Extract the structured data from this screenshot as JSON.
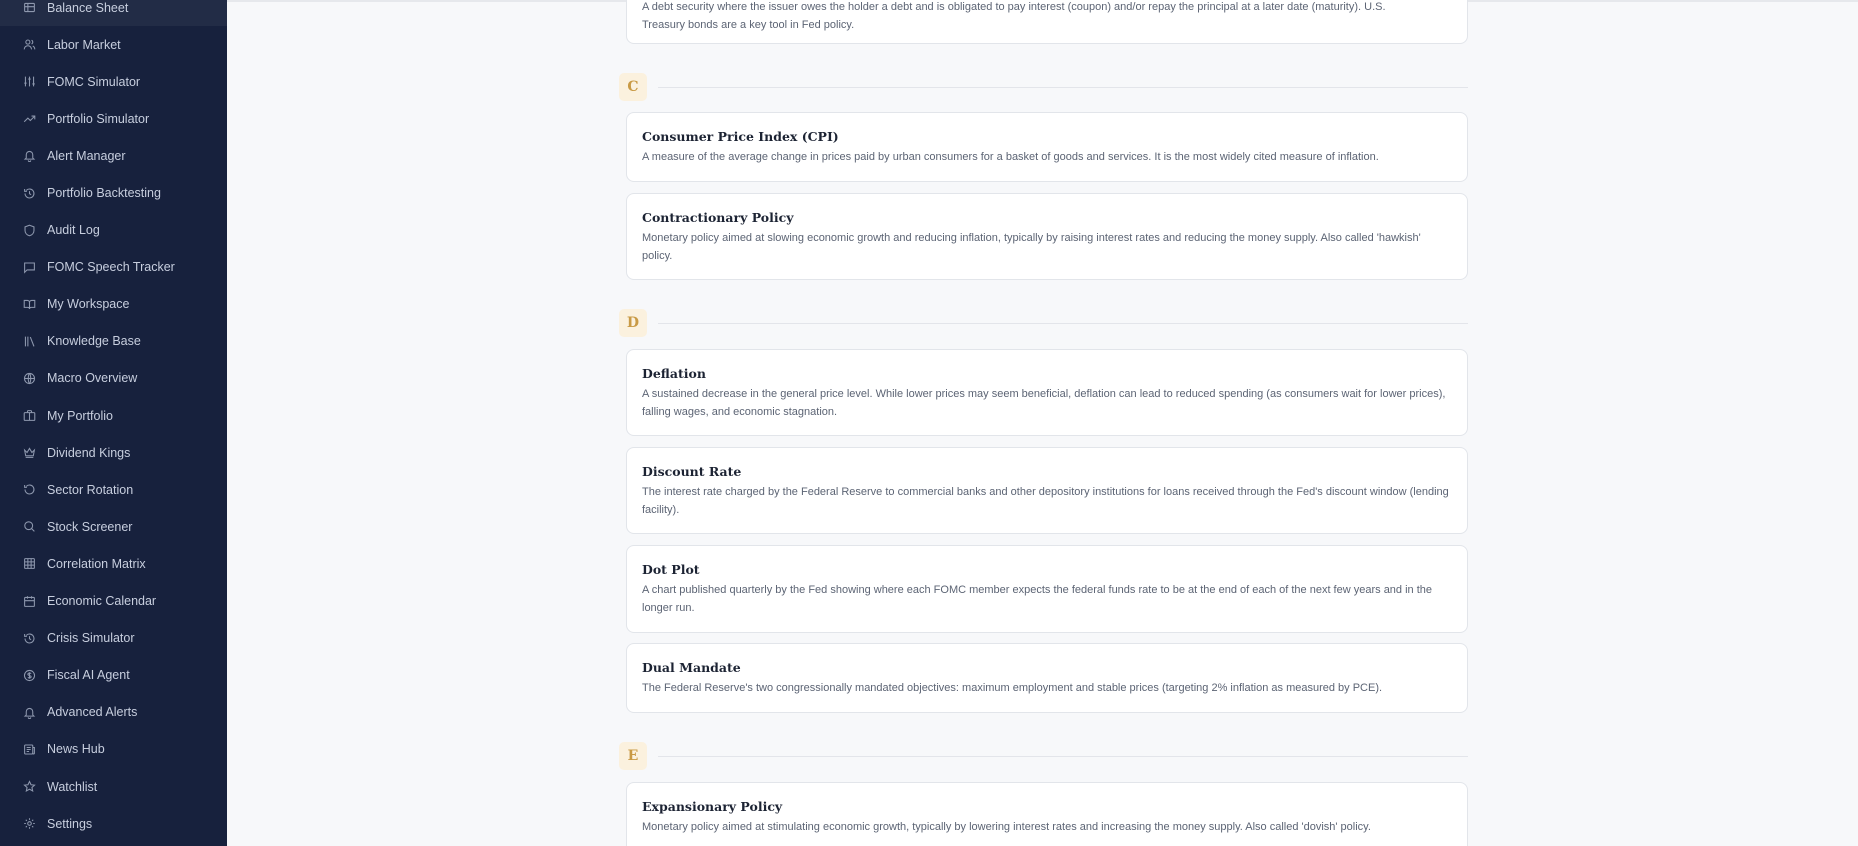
{
  "sidebar": {
    "items": [
      {
        "label": "Balance Sheet",
        "icon": "balance-icon"
      },
      {
        "label": "Labor Market",
        "icon": "users-icon"
      },
      {
        "label": "FOMC Simulator",
        "icon": "sliders-icon"
      },
      {
        "label": "Portfolio Simulator",
        "icon": "trending-up-icon"
      },
      {
        "label": "Alert Manager",
        "icon": "bell-icon"
      },
      {
        "label": "Portfolio Backtesting",
        "icon": "history-icon"
      },
      {
        "label": "Audit Log",
        "icon": "shield-icon"
      },
      {
        "label": "FOMC Speech Tracker",
        "icon": "message-square-icon"
      },
      {
        "label": "My Workspace",
        "icon": "book-open-icon"
      },
      {
        "label": "Knowledge Base",
        "icon": "library-icon"
      },
      {
        "label": "Macro Overview",
        "icon": "globe-icon"
      },
      {
        "label": "My Portfolio",
        "icon": "briefcase-icon"
      },
      {
        "label": "Dividend Kings",
        "icon": "crown-icon"
      },
      {
        "label": "Sector Rotation",
        "icon": "rotate-icon"
      },
      {
        "label": "Stock Screener",
        "icon": "search-icon"
      },
      {
        "label": "Correlation Matrix",
        "icon": "grid-icon"
      },
      {
        "label": "Economic Calendar",
        "icon": "calendar-icon"
      },
      {
        "label": "Crisis Simulator",
        "icon": "history-icon"
      },
      {
        "label": "Fiscal AI Agent",
        "icon": "coin-icon"
      },
      {
        "label": "Advanced Alerts",
        "icon": "bell-icon"
      },
      {
        "label": "News Hub",
        "icon": "newspaper-icon"
      },
      {
        "label": "Watchlist",
        "icon": "star-icon"
      },
      {
        "label": "Settings",
        "icon": "gear-icon"
      }
    ]
  },
  "glossary": {
    "partial_top": {
      "definition_line1": "A debt security where the issuer owes the holder a debt and is obligated to pay interest (coupon) and/or repay the principal at a later date (maturity). U.S.",
      "definition_line2": "Treasury bonds are a key tool in Fed policy."
    },
    "sections": [
      {
        "letter": "C",
        "terms": [
          {
            "term": "Consumer Price Index (CPI)",
            "definition": "A measure of the average change in prices paid by urban consumers for a basket of goods and services. It is the most widely cited measure of inflation."
          },
          {
            "term": "Contractionary Policy",
            "definition": "Monetary policy aimed at slowing economic growth and reducing inflation, typically by raising interest rates and reducing the money supply. Also called 'hawkish' policy."
          }
        ]
      },
      {
        "letter": "D",
        "terms": [
          {
            "term": "Deflation",
            "definition": "A sustained decrease in the general price level. While lower prices may seem beneficial, deflation can lead to reduced spending (as consumers wait for lower prices), falling wages, and economic stagnation."
          },
          {
            "term": "Discount Rate",
            "definition": "The interest rate charged by the Federal Reserve to commercial banks and other depository institutions for loans received through the Fed's discount window (lending facility)."
          },
          {
            "term": "Dot Plot",
            "definition": "A chart published quarterly by the Fed showing where each FOMC member expects the federal funds rate to be at the end of each of the next few years and in the longer run."
          },
          {
            "term": "Dual Mandate",
            "definition": "The Federal Reserve's two congressionally mandated objectives: maximum employment and stable prices (targeting 2% inflation as measured by PCE)."
          }
        ]
      },
      {
        "letter": "E",
        "terms": [
          {
            "term": "Expansionary Policy",
            "definition": "Monetary policy aimed at stimulating economic growth, typically by lowering interest rates and increasing the money supply. Also called 'dovish' policy."
          }
        ]
      }
    ]
  },
  "colors": {
    "sidebar_bg": "#17213d",
    "accent_gold": "#c99a45",
    "badge_bg": "#fbf1de"
  }
}
